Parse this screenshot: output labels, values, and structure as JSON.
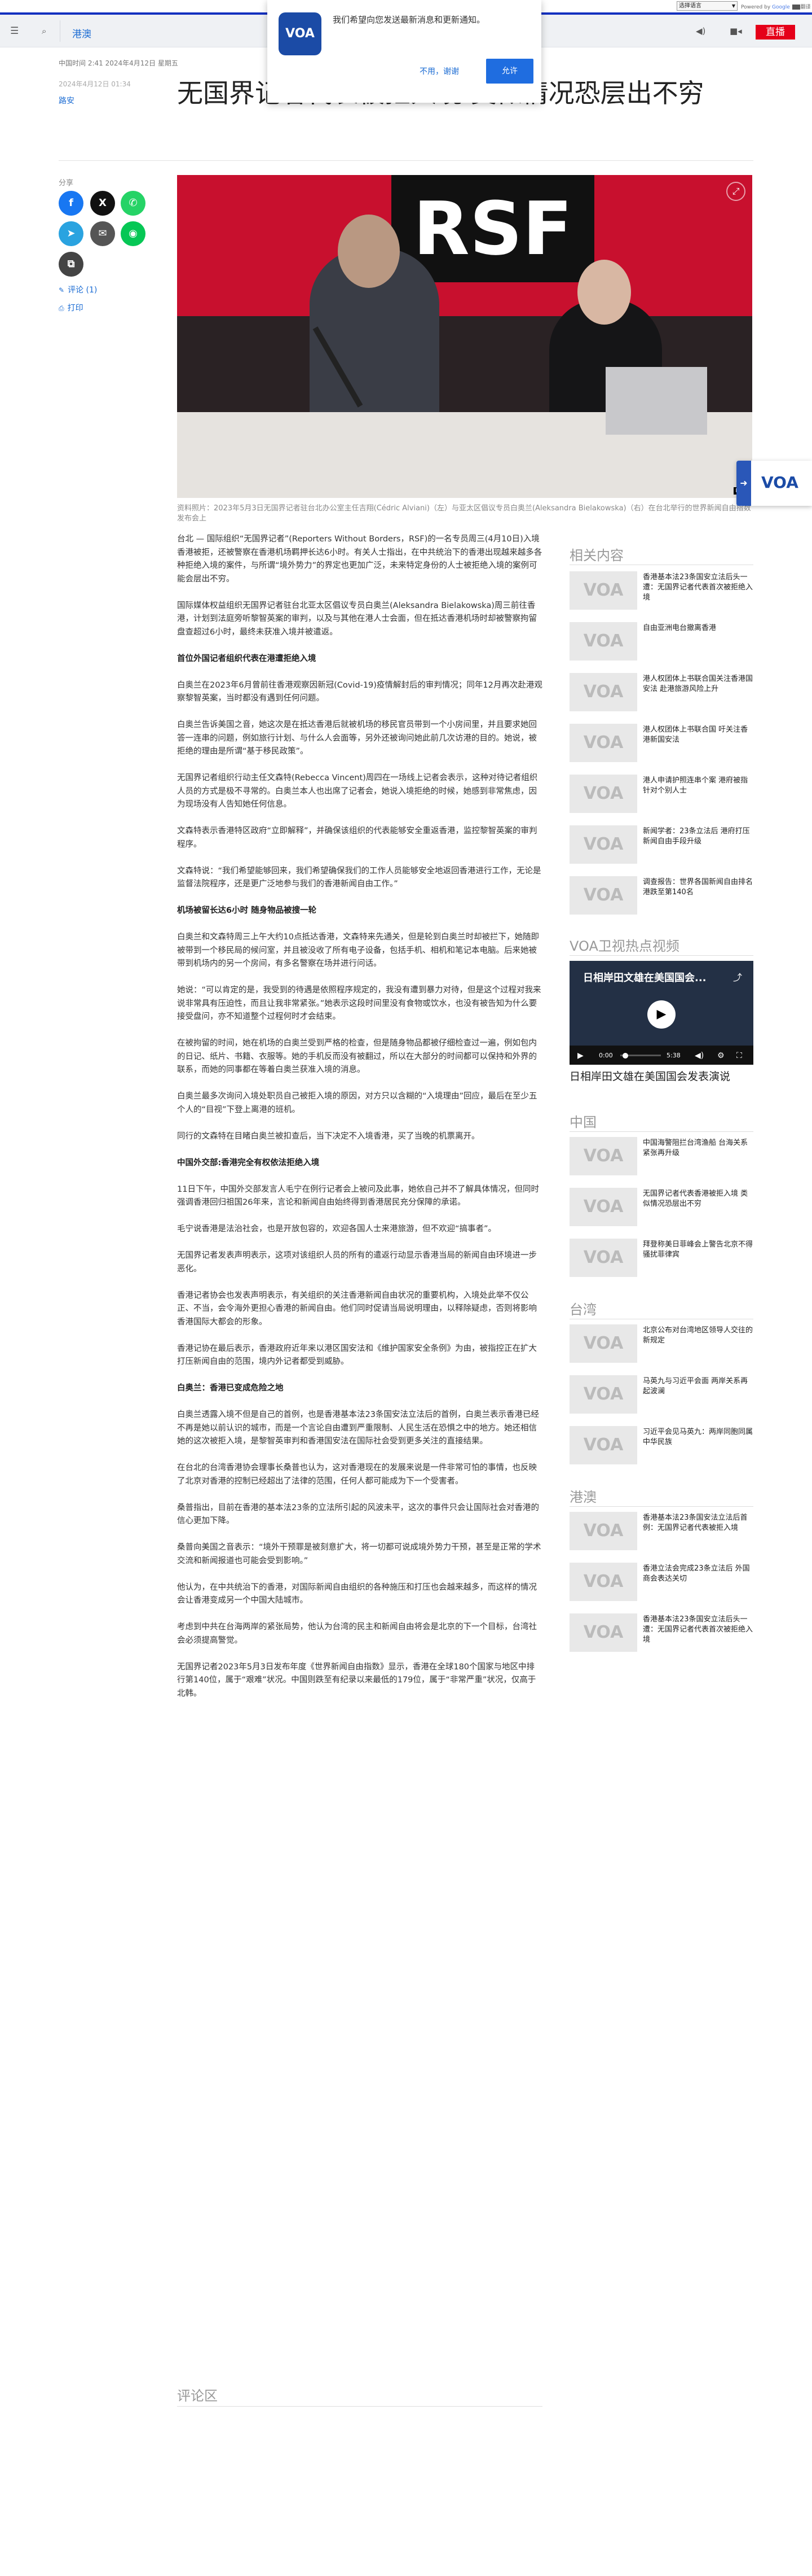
{
  "translate": {
    "select_label": "选择语言",
    "powered": "Powered by",
    "google": "Google",
    "translate_label": "翻译"
  },
  "nav": {
    "section": "港澳",
    "live_label": "直播",
    "menu_icon": "hamburger-icon",
    "search_icon": "search-icon",
    "audio_icon": "speaker-icon",
    "video_icon": "video-camera-icon"
  },
  "modal": {
    "logo": "VOA",
    "message": "我们希望向您发送最新消息和更新通知。",
    "decline": "不用，谢谢",
    "accept": "允许"
  },
  "article": {
    "meta": "中国时间 2:41 2024年4月12日 星期五",
    "date": "2024年4月12日 01:34",
    "author": "路安",
    "title": "无国界记者代表被拒入境 类似情况恐层出不穷",
    "share_label": "分享",
    "comments_link": "评论 (1)",
    "print_link": "打印",
    "caption": "资料照片：2023年5月3日无国界记者驻台北办公室主任吉翔(Cédric Alviani)（左）与亚太区倡议专员白奥兰(Aleksandra Bielakowska)（右）在台北举行的世界新闻自由指数发布会上",
    "image_credit": "RSF"
  },
  "body": [
    {
      "type": "p",
      "text": "台北 — 国际组织“无国界记者”(Reporters Without Borders，RSF)的一名专员周三(4月10日)入境香港被拒，还被警察在香港机场羁押长达6小时。有关人士指出，在中共统治下的香港出现越来越多各种拒绝入境的案件，与所谓“境外势力”的界定也更加广泛，未来特定身份的人士被拒绝入境的案例可能会层出不穷。"
    },
    {
      "type": "p",
      "text": "国际媒体权益组织无国界记者驻台北亚太区倡议专员白奥兰(Aleksandra Bielakowska)周三前往香港，计划到法庭旁听黎智英案的审判，以及与其他在港人士会面，但在抵达香港机场时却被警察拘留盘查超过6小时，最终未获准入境并被遣返。"
    },
    {
      "type": "h",
      "text": "首位外国记者组织代表在港遭拒绝入境"
    },
    {
      "type": "p",
      "text": "白奥兰在2023年6月曾前往香港观察因新冠(Covid-19)疫情解封后的审判情况；同年12月再次赴港观察黎智英案，当时都没有遇到任何问题。"
    },
    {
      "type": "p",
      "text": "白奥兰告诉美国之音，她这次是在抵达香港后就被机场的移民官员带到一个小房间里，并且要求她回答一连串的问题，例如旅行计划、与什么人会面等，另外还被询问她此前几次访港的目的。她说，被拒绝的理由是所谓“基于移民政策”。"
    },
    {
      "type": "p",
      "text": "无国界记者组织行动主任文森特(Rebecca Vincent)周四在一场线上记者会表示，这种对待记者组织人员的方式是极不寻常的。白奥兰本人也出席了记者会，她说入境拒绝的时候，她感到非常焦虑，因为现场没有人告知她任何信息。"
    },
    {
      "type": "p",
      "text": "文森特表示香港特区政府“立即解释”，并确保该组织的代表能够安全重返香港，监控黎智英案的审判程序。"
    },
    {
      "type": "p",
      "text": "文森特说：“我们希望能够回来，我们希望确保我们的工作人员能够安全地返回香港进行工作，无论是监督法院程序，还是更广泛地参与我们的香港新闻自由工作。”"
    },
    {
      "type": "h",
      "text": "机场被留长达6小时 随身物品被搜一轮"
    },
    {
      "type": "p",
      "text": "白奥兰和文森特周三上午大约10点抵达香港，文森特来先通关，但是轮到白奥兰时却被拦下，她随即被带到一个移民局的候问室，并且被没收了所有电子设备，包括手机、相机和笔记本电脑。后来她被带到机场内的另一个房间，有多名警察在场并进行问话。"
    },
    {
      "type": "p",
      "text": "她说：“可以肯定的是，我受到的待遇是依照程序规定的，我没有遭到暴力对待，但是这个过程对我来说非常具有压迫性，而且让我非常紧张。”她表示这段时间里没有食物或饮水，也没有被告知为什么要接受盘问，亦不知道整个过程何时才会结束。"
    },
    {
      "type": "p",
      "text": "在被拘留的时间，她在机场的白奥兰受到严格的检查，但是随身物品都被仔细检查过一遍，例如包内的日记、纸片、书籍、衣服等。她的手机反而没有被翻过，所以在大部分的时间都可以保持和外界的联系，而她的同事都在等着白奥兰获准入境的消息。"
    },
    {
      "type": "p",
      "text": "白奥兰最多次询问入境处职员自己被拒入境的原因，对方只以含糊的“入境理由”回应，最后在至少五个人的“目视”下登上离港的班机。"
    },
    {
      "type": "p",
      "text": "同行的文森特在目睹白奥兰被扣查后，当下决定不入境香港，买了当晚的机票离开。"
    },
    {
      "type": "h",
      "text": "中国外交部:香港完全有权依法拒绝入境"
    },
    {
      "type": "p",
      "text": "11日下午，中国外交部发言人毛宁在例行记者会上被问及此事，她依自己并不了解具体情况，但同时强调香港回归祖国26年来，言论和新闻自由始终得到香港居民充分保障的承诺。"
    },
    {
      "type": "p",
      "text": "毛宁说香港是法治社会，也是开放包容的，欢迎各国人士来港旅游，但不欢迎“搞事者”。"
    },
    {
      "type": "p",
      "text": "无国界记者发表声明表示，这项对该组织人员的所有的遣返行动显示香港当局的新闻自由环境进一步恶化。"
    },
    {
      "type": "p",
      "text": "香港记者协会也发表声明表示，有关组织的关注香港新闻自由状况的重要机构，入境处此举不仅公正、不当，会令海外更担心香港的新闻自由。他们同时促请当局说明理由，以释除疑虑，否则将影响香港国际大都会的形象。"
    },
    {
      "type": "p",
      "text": "香港记协在最后表示，香港政府近年来以港区国安法和《维护国家安全条例》为由，被指控正在扩大打压新闻自由的范围，境内外记者都受到威胁。"
    },
    {
      "type": "h",
      "text": "白奥兰：香港已变成危险之地"
    },
    {
      "type": "p",
      "text": "白奥兰透露入境不但是自己的首例，也是香港基本法23条国安法立法后的首例，白奥兰表示香港已经不再是她以前认识的城市，而是一个言论自由遭到严重限制、人民生活在恐惧之中的地方。她还相信她的这次被拒入境，是黎智英审判和香港国安法在国际社会受到更多关注的直接结果。"
    },
    {
      "type": "p",
      "text": "在台北的台湾香港协会理事长桑普也认为，这对香港现在的发展来说是一件非常可怕的事情，也反映了北京对香港的控制已经超出了法律的范围，任何人都可能成为下一个受害者。"
    },
    {
      "type": "p",
      "text": "桑普指出，目前在香港的基本法23条的立法所引起的风波未平，这次的事件只会让国际社会对香港的信心更加下降。"
    },
    {
      "type": "p",
      "text": "桑普向美国之音表示：“境外干预罪是被刻意扩大，将一切都可说成境外势力干预，甚至是正常的学术交流和新闻报道也可能会受到影响。”"
    },
    {
      "type": "p",
      "text": "他认为，在中共统治下的香港，对国际新闻自由组织的各种施压和打压也会越来越多，而这样的情况会让香港变成另一个中国大陆城市。"
    },
    {
      "type": "p",
      "text": "考虑到中共在台海两岸的紧张局势，他认为台湾的民主和新闻自由将会是北京的下一个目标，台湾社会必须提高警觉。"
    },
    {
      "type": "p",
      "text": "无国界记者2023年5月3日发布年度《世界新闻自由指数》显示，香港在全球180个国家与地区中排行第140位，属于“艰难”状况。中国则跌至有纪录以来最低的179位，属于“非常严重”状况，仅高于北韩。"
    }
  ],
  "comments": {
    "title": "评论区"
  },
  "sidebar": {
    "related_title": "相关内容",
    "related": [
      "香港基本法23条国安立法后头一遭：无国界记者代表首次被拒绝入境",
      "自由亚洲电台撤离香港",
      "港人权团体上书联合国关注香港国安法 赴港旅游风险上升",
      "港人权团体上书联合国 吁关注香港新国安法",
      "港人申请护照连串个案 港府被指针对个别人士",
      "新闻学者：23条立法后 港府打压新闻自由手段升级",
      "调查报告：世界各国新闻自由排名 港跌至第140名"
    ],
    "video_title": "VOA卫视热点视频",
    "video": {
      "title": "日相岸田文雄在美国国会...",
      "time_current": "0:00",
      "time_total": "5:38",
      "caption": "日相岸田文雄在美国国会发表演说",
      "play_icon": "play-icon",
      "share_icon": "share-icon",
      "mute_icon": "volume-icon",
      "settings_icon": "gear-icon",
      "fullscreen_icon": "fullscreen-icon"
    },
    "china_title": "中国",
    "china": [
      "中国海警阻拦台湾渔船 台海关系紧张再升级",
      "无国界记者代表香港被拒入境 类似情况恐层出不穷",
      "拜登称美日菲峰会上警告北京不得骚扰菲律宾"
    ],
    "taiwan_title": "台湾",
    "taiwan": [
      "北京公布对台湾地区领导人交往的新规定",
      "马英九与习近平会面 两岸关系再起波澜",
      "习近平会见马英九：两岸同胞同属中华民族"
    ],
    "hk_title": "港澳",
    "hk": [
      "香港基本法23条国安法立法后首例：无国界记者代表被拒入境",
      "香港立法会完成23条立法后 外国商会表达关切",
      "香港基本法23条国安立法后头一遭：无国界记者代表首次被拒绝入境"
    ],
    "thumb_logo": "VOA"
  },
  "sticky": {
    "logo": "VOA"
  },
  "colors": {
    "brand": "#1330bf",
    "link": "#1a6bd3",
    "live": "#e50019"
  }
}
